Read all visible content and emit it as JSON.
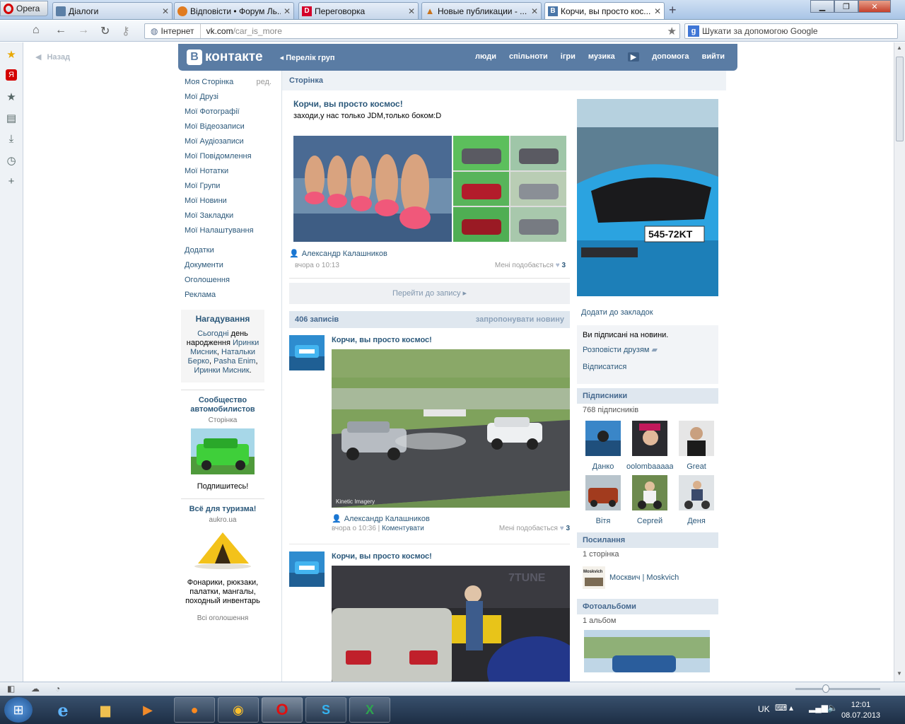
{
  "browser": {
    "menu_label": "Opera",
    "tabs": [
      {
        "title": "Діалоги",
        "favicon_color": "#5b7fa6",
        "favicon_text": "",
        "active": false
      },
      {
        "title": "Відповісти • Форум Ль...",
        "favicon_color": "#e07b20",
        "favicon_text": "",
        "active": false
      },
      {
        "title": "Переговорка",
        "favicon_color": "#d4002a",
        "favicon_text": "D",
        "active": false
      },
      {
        "title": "Новые публикации - ...",
        "favicon_color": "#c8731c",
        "favicon_text": "",
        "active": false
      },
      {
        "title": "Корчи, вы просто кос...",
        "favicon_color": "#4a76a8",
        "favicon_text": "В",
        "active": true
      }
    ],
    "new_tab_symbol": "+",
    "address": {
      "scope": "Інтернет",
      "host": "vk.com",
      "path": "/car_is_more"
    },
    "search_placeholder": "Шукати за допомогою Google",
    "search_engine_letter": "g"
  },
  "page": {
    "back_label": "Назад",
    "logo": {
      "badge": "В",
      "text": "контакте"
    },
    "group_list_label": "Перелік груп",
    "top_nav": [
      "люди",
      "спільноти",
      "ігри",
      "музика",
      "допомога",
      "вийти"
    ],
    "left_menu": [
      {
        "label": "Моя Сторінка",
        "extra": "ред."
      },
      {
        "label": "Мої Друзі"
      },
      {
        "label": "Мої Фотографії"
      },
      {
        "label": "Мої Відеозаписи"
      },
      {
        "label": "Мої Аудіозаписи"
      },
      {
        "label": "Мої Повідомлення"
      },
      {
        "label": "Мої Нотатки"
      },
      {
        "label": "Мої Групи"
      },
      {
        "label": "Мої Новини"
      },
      {
        "label": "Мої Закладки"
      },
      {
        "label": "Мої Налаштування"
      }
    ],
    "left_menu_2": [
      "Додатки",
      "Документи",
      "Оголошення",
      "Реклама"
    ],
    "reminder": {
      "title": "Нагадування",
      "today": "Сьогодні",
      "text1": " день народження ",
      "names": [
        "Иринки Мисник",
        "Натальки Берко",
        "Pasha Enim",
        "Иринки Мисник"
      ]
    },
    "ads": [
      {
        "title": "Сообщество автомобилистов",
        "sub": "Сторінка",
        "text": "Подпишитесь!"
      },
      {
        "title": "Всё для туризма!",
        "sub": "aukro.ua",
        "text": "Фонарики, рюкзаки, палатки, мангалы, походный инвентарь"
      }
    ],
    "all_ads_label": "Всі оголошення",
    "breadcrumb": "Сторінка",
    "group": {
      "name": "Корчи, вы просто космос!",
      "description": "заходи,у нас только JDM,только боком:D"
    },
    "fixed_post": {
      "author": "Александр Калашников",
      "time": "вчора о 10:13",
      "like_label": "Мені подобається",
      "likes": "3"
    },
    "go_to_post_label": "Перейти до запису",
    "wall": {
      "count_label": "406 записів",
      "suggest_label": "запропонувати новину"
    },
    "posts": [
      {
        "title": "Корчи, вы просто космос!",
        "author": "Александр Калашников",
        "time": "вчора о 10:36",
        "comment_label": "Коментувати",
        "like_label": "Мені подобається",
        "likes": "3",
        "watermark": "Kinetic Imagery"
      },
      {
        "title": "Корчи, вы просто космос!",
        "watermark": "7TUNE"
      }
    ],
    "side": {
      "plate": "545-72KT",
      "add_bookmark": "Додати до закладок",
      "subscribed_text": "Ви підписані на новини.",
      "tell_friends": "Розповісти друзям",
      "unsubscribe": "Відписатися",
      "subscribers_title": "Підписники",
      "subscribers_count": "768 підписників",
      "subscribers": [
        "Данко",
        "oolombaaaaaa",
        "Great",
        "Вітя",
        "Сергей",
        "Деня"
      ],
      "links_title": "Посилання",
      "links_count": "1 сторінка",
      "link_name": "Москвич | Moskvich",
      "link_logo_text": "Moskvich",
      "albums_title": "Фотоальбоми",
      "albums_count": "1 альбом"
    }
  },
  "status_bar": {},
  "taskbar": {
    "lang": "UK",
    "time": "12:01",
    "date": "08.07.2013"
  },
  "colors": {
    "vk_header": "#5a7ca4",
    "vk_link": "#2b587a",
    "vk_section_header": "#dfe7ef"
  }
}
